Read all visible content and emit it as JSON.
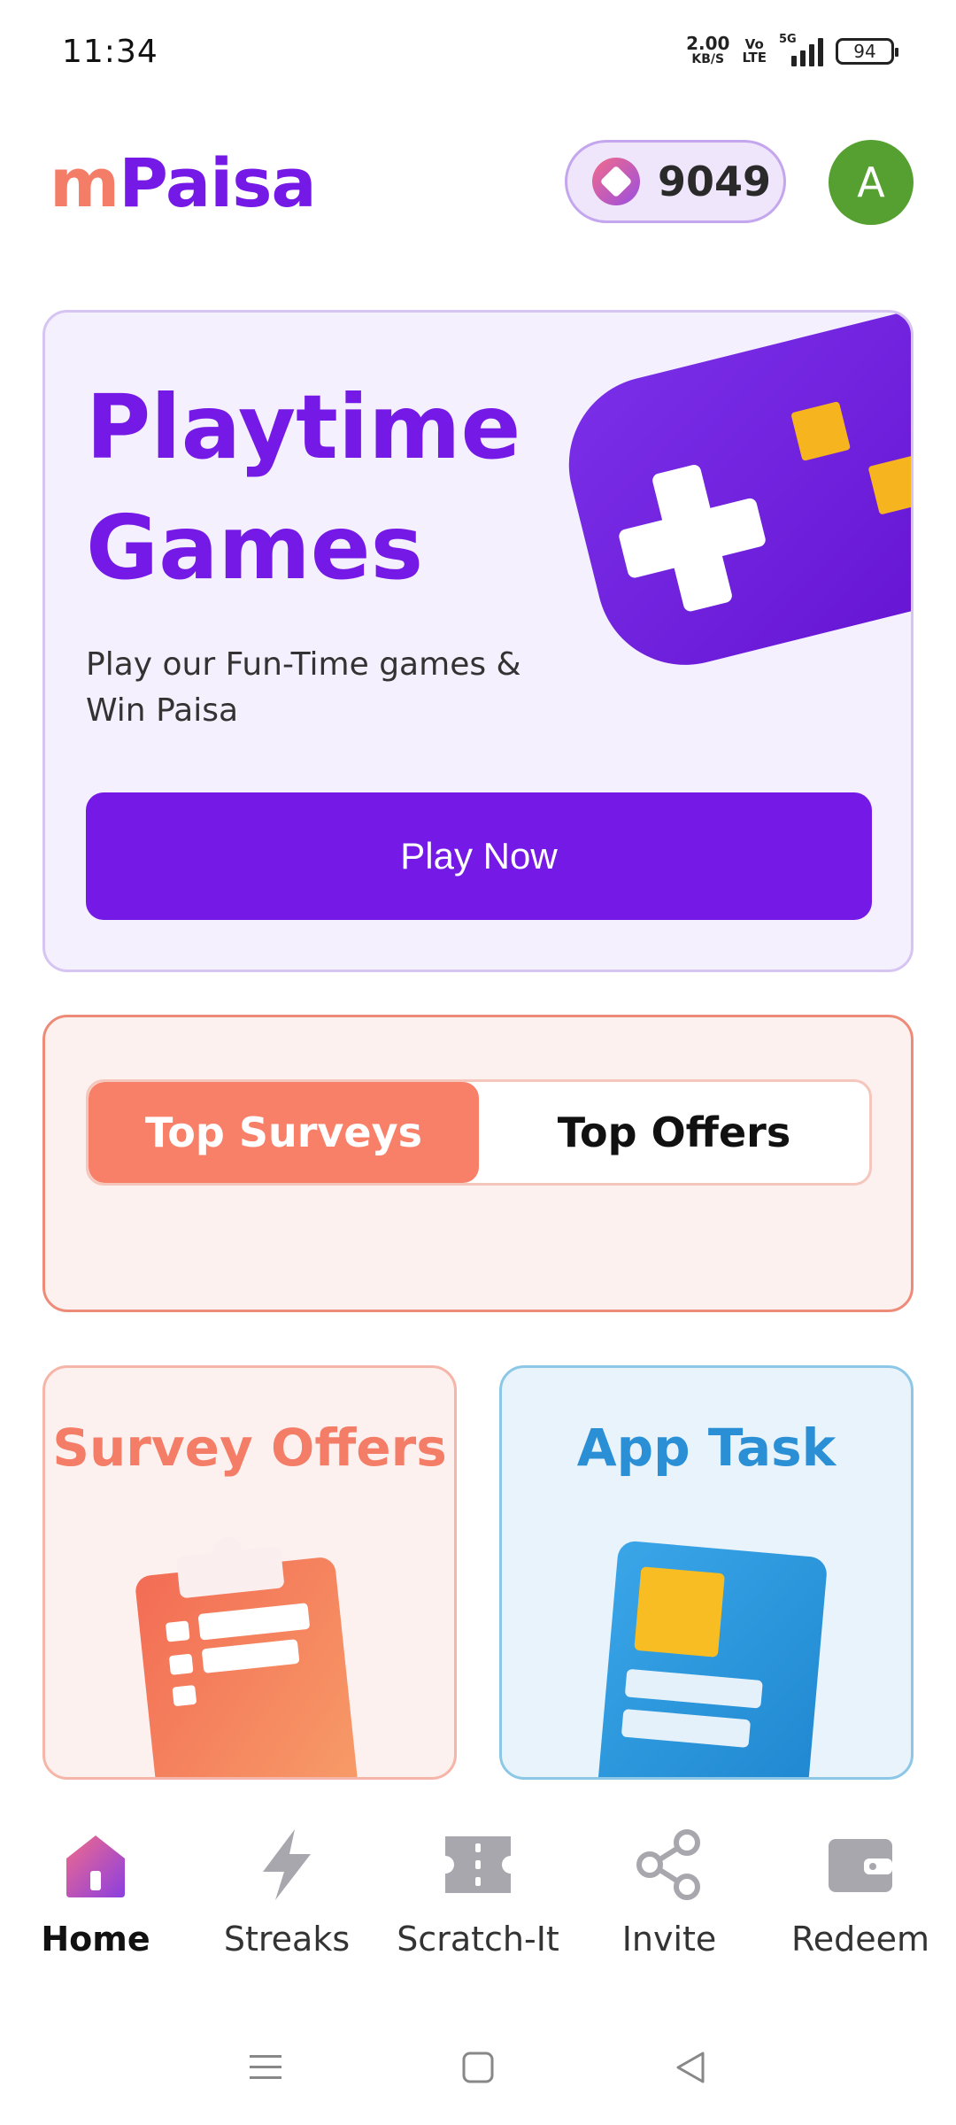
{
  "status_bar": {
    "time": "11:34",
    "net_speed": "2.00",
    "net_unit": "KB/S",
    "volte_top": "Vo",
    "volte_bottom": "LTE",
    "network": "5G",
    "battery": "94"
  },
  "header": {
    "logo_m": "m",
    "logo_paisa": "Paisa",
    "coins": "9049",
    "avatar_initial": "A"
  },
  "playtime": {
    "title_line1": "Playtime",
    "title_line2": "Games",
    "subtitle": "Play our Fun-Time games & Win Paisa",
    "button": "Play Now",
    "image": "game-controller-icon"
  },
  "toggle": {
    "tabs": [
      {
        "label": "Top Surveys",
        "active": true
      },
      {
        "label": "Top Offers",
        "active": false
      }
    ]
  },
  "cards": [
    {
      "title": "Survey Offers",
      "icon": "clipboard-icon"
    },
    {
      "title": "App Task",
      "icon": "document-icon"
    }
  ],
  "bottom_nav": {
    "items": [
      {
        "label": "Home",
        "icon": "home-icon",
        "active": true
      },
      {
        "label": "Streaks",
        "icon": "lightning-icon",
        "active": false
      },
      {
        "label": "Scratch-It",
        "icon": "ticket-icon",
        "active": false
      },
      {
        "label": "Invite",
        "icon": "share-icon",
        "active": false
      },
      {
        "label": "Redeem",
        "icon": "wallet-icon",
        "active": false
      }
    ]
  },
  "colors": {
    "brand_purple": "#7419e6",
    "brand_coral": "#f47d68",
    "app_task_blue": "#2b8fd6",
    "avatar_green": "#55a031"
  }
}
